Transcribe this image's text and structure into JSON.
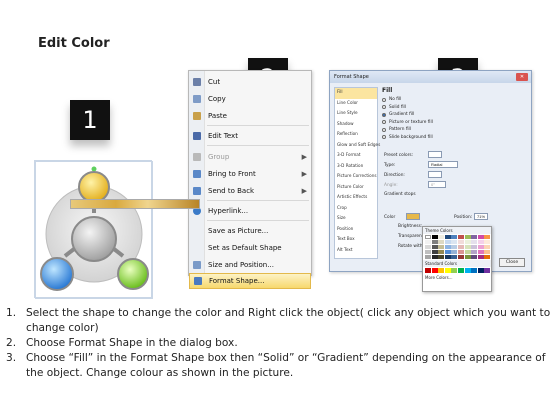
{
  "title": "Edit Color",
  "badges": [
    "1",
    "2",
    "3"
  ],
  "context_menu": {
    "items": [
      {
        "label": "Cut",
        "icon": "scissors-icon",
        "color": "#6b7fa8"
      },
      {
        "label": "Copy",
        "icon": "copy-icon",
        "color": "#7e9bc7"
      },
      {
        "label": "Paste",
        "icon": "paste-icon",
        "color": "#c9a04a"
      },
      {
        "label": "Edit Text",
        "icon": "edit-text-icon",
        "color": "#4a6aa8"
      },
      {
        "label": "Group",
        "icon": "group-icon",
        "color": "#b9b9b9",
        "disabled": true,
        "submenu": true
      },
      {
        "label": "Bring to Front",
        "icon": "bring-front-icon",
        "color": "#5a88c8",
        "submenu": true
      },
      {
        "label": "Send to Back",
        "icon": "send-back-icon",
        "color": "#5a88c8",
        "submenu": true
      },
      {
        "label": "Hyperlink...",
        "icon": "hyperlink-icon",
        "color": "#3a7ac8"
      },
      {
        "label": "Save as Picture...",
        "icon": "",
        "color": ""
      },
      {
        "label": "Set as Default Shape",
        "icon": "",
        "color": ""
      },
      {
        "label": "Size and Position...",
        "icon": "size-position-icon",
        "color": "#7a9ac8"
      },
      {
        "label": "Format Shape...",
        "icon": "format-shape-icon",
        "color": "#4a7ac0",
        "highlight": true
      }
    ]
  },
  "dialog": {
    "title": "Format Shape",
    "close_label": "Close",
    "categories": [
      "Fill",
      "Line Color",
      "Line Style",
      "Shadow",
      "Reflection",
      "Glow and Soft Edges",
      "3-D Format",
      "3-D Rotation",
      "Picture Corrections",
      "Picture Color",
      "Artistic Effects",
      "Crop",
      "Size",
      "Position",
      "Text Box",
      "Alt Text"
    ],
    "fill_heading": "Fill",
    "fill_options": [
      "No fill",
      "Solid fill",
      "Gradient fill",
      "Picture or texture fill",
      "Pattern fill",
      "Slide background fill"
    ],
    "selected_fill": "Gradient fill",
    "preset_colors_label": "Preset colors:",
    "type_label": "Type:",
    "type_value": "Radial",
    "direction_label": "Direction:",
    "angle_label": "Angle:",
    "angle_value": "0°",
    "gradient_stops_label": "Gradient stops",
    "color_label": "Color",
    "position_label": "Position:",
    "position_value": "71%",
    "brightness_label": "Brightness:",
    "transparency_label": "Transparency:",
    "rotate_label": "Rotate with shape",
    "palette": {
      "theme_label": "Theme Colors",
      "standard_label": "Standard Colors",
      "more_label": "More Colors..."
    }
  },
  "instructions": [
    {
      "num": "1.",
      "text": "Select the shape to change the color and Right click the object( click any object which you want to change color)"
    },
    {
      "num": "2.",
      "text": "Choose Format Shape in the dialog box."
    },
    {
      "num": "3.",
      "text": "Choose “Fill” in the Format Shape box then “Solid” or “Gradient” depending on the appearance of the object. Change colour as shown in the picture."
    }
  ],
  "colors": {
    "circle_top": "#f2c21f",
    "circle_left": "#2f8be0",
    "circle_right": "#7dd11f"
  }
}
